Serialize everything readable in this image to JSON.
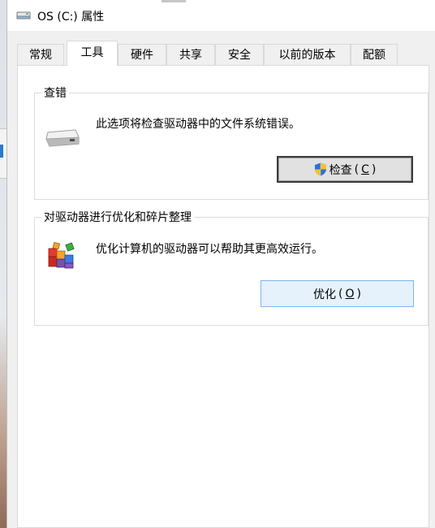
{
  "window": {
    "title": "OS (C:) 属性"
  },
  "tabs": [
    {
      "label": "常规",
      "active": false
    },
    {
      "label": "工具",
      "active": true
    },
    {
      "label": "硬件",
      "active": false
    },
    {
      "label": "共享",
      "active": false
    },
    {
      "label": "安全",
      "active": false
    },
    {
      "label": "以前的版本",
      "active": false
    },
    {
      "label": "配额",
      "active": false
    }
  ],
  "error_check": {
    "title": "查错",
    "description": "此选项将检查驱动器中的文件系统错误。",
    "button_label": "检查",
    "button_key_open": "(",
    "button_key": "C",
    "button_key_close": ")",
    "icon": "drive-icon",
    "button_icon": "uac-shield-icon"
  },
  "optimize": {
    "title": "对驱动器进行优化和碎片整理",
    "description": "优化计算机的驱动器可以帮助其更高效运行。",
    "button_label": "优化",
    "button_key_open": "(",
    "button_key": "O",
    "button_key_close": ")",
    "icon": "defrag-icon"
  },
  "colors": {
    "dialog_bg": "#f0f0f0",
    "panel_bg": "#ffffff",
    "button_default_border": "#3c3c3c",
    "button_hover_bg": "#e5f1fb",
    "button_hover_border": "#7eb4ea"
  }
}
